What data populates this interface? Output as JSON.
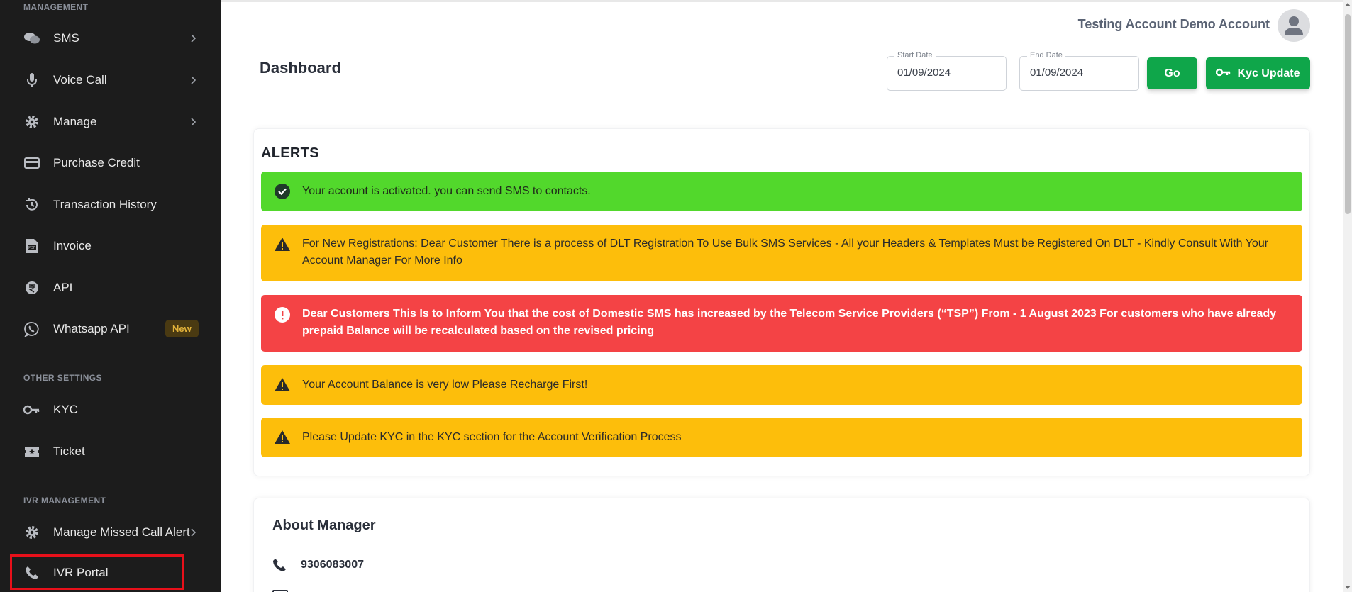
{
  "sidebar": {
    "section_management": "MANAGEMENT",
    "items": [
      {
        "label": "SMS",
        "icon": "chat-bubbles-icon"
      },
      {
        "label": "Voice Call",
        "icon": "microphone-icon"
      },
      {
        "label": "Manage",
        "icon": "gear-icon"
      },
      {
        "label": "Purchase Credit",
        "icon": "credit-card-icon"
      },
      {
        "label": "Transaction History",
        "icon": "history-icon"
      },
      {
        "label": "Invoice",
        "icon": "pdf-file-icon"
      },
      {
        "label": "API",
        "icon": "rupee-coin-icon"
      },
      {
        "label": "Whatsapp API",
        "icon": "whatsapp-icon",
        "badge": "New"
      }
    ],
    "section_other": "OTHER SETTINGS",
    "other_items": [
      {
        "label": "KYC",
        "icon": "key-icon"
      },
      {
        "label": "Ticket",
        "icon": "ticket-icon"
      }
    ],
    "section_ivr": "IVR MANAGEMENT",
    "ivr_items": [
      {
        "label": "Manage Missed Call Alert",
        "icon": "gear-icon"
      },
      {
        "label": "IVR Portal",
        "icon": "phone-icon"
      }
    ]
  },
  "header": {
    "user_name": "Testing Account Demo Account",
    "page_title": "Dashboard",
    "start_date_label": "Start Date",
    "start_date_value": "01/09/2024",
    "end_date_label": "End Date",
    "end_date_value": "01/09/2024",
    "go_label": "Go",
    "kyc_label": "Kyc Update"
  },
  "alerts": {
    "title": "ALERTS",
    "items": [
      {
        "type": "success",
        "text": "Your account is activated. you can send SMS to contacts."
      },
      {
        "type": "warning",
        "text": "For New Registrations: Dear Customer There is a process of DLT Registration To Use Bulk SMS Services - All your Headers & Templates Must be Registered On DLT - Kindly Consult With Your Account Manager For More Info"
      },
      {
        "type": "danger",
        "text": "Dear Customers This Is to Inform You that the cost of Domestic SMS has increased by the Telecom Service Providers (“TSP”) From - 1 August 2023 For customers who have already prepaid Balance will be recalculated based on the revised pricing"
      },
      {
        "type": "warning",
        "text": "Your Account Balance is very low Please Recharge First!"
      },
      {
        "type": "warning",
        "text": "Please Update KYC in the KYC section for the Account Verification Process"
      }
    ]
  },
  "manager": {
    "title": "About Manager",
    "phone": "9306083007"
  },
  "colors": {
    "sidebar_bg": "#1c1c1c",
    "success": "#52d82c",
    "warning": "#fdbe0b",
    "danger": "#f44345",
    "primary_button": "#0fa64a",
    "highlight": "#e8101a"
  }
}
